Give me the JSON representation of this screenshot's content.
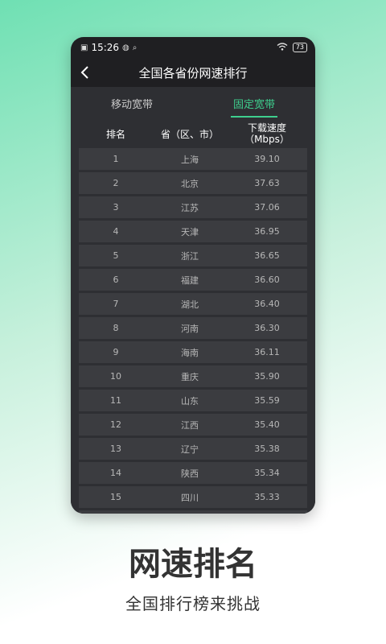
{
  "status_bar": {
    "time": "15:26",
    "battery": "73"
  },
  "nav": {
    "title": "全国各省份网速排行"
  },
  "tabs": [
    {
      "label": "移动宽带",
      "active": false
    },
    {
      "label": "固定宽带",
      "active": true
    }
  ],
  "table": {
    "headers": {
      "rank": "排名",
      "province": "省（区、市）",
      "speed_line1": "下载速度",
      "speed_line2": "（Mbps）"
    },
    "rows": [
      {
        "rank": "1",
        "province": "上海",
        "speed": "39.10"
      },
      {
        "rank": "2",
        "province": "北京",
        "speed": "37.63"
      },
      {
        "rank": "3",
        "province": "江苏",
        "speed": "37.06"
      },
      {
        "rank": "4",
        "province": "天津",
        "speed": "36.95"
      },
      {
        "rank": "5",
        "province": "浙江",
        "speed": "36.65"
      },
      {
        "rank": "6",
        "province": "福建",
        "speed": "36.60"
      },
      {
        "rank": "7",
        "province": "湖北",
        "speed": "36.40"
      },
      {
        "rank": "8",
        "province": "河南",
        "speed": "36.30"
      },
      {
        "rank": "9",
        "province": "海南",
        "speed": "36.11"
      },
      {
        "rank": "10",
        "province": "重庆",
        "speed": "35.90"
      },
      {
        "rank": "11",
        "province": "山东",
        "speed": "35.59"
      },
      {
        "rank": "12",
        "province": "江西",
        "speed": "35.40"
      },
      {
        "rank": "13",
        "province": "辽宁",
        "speed": "35.38"
      },
      {
        "rank": "14",
        "province": "陕西",
        "speed": "35.34"
      },
      {
        "rank": "15",
        "province": "四川",
        "speed": "35.33"
      }
    ]
  },
  "promo": {
    "title": "网速排名",
    "subtitle": "全国排行榜来挑战"
  },
  "colors": {
    "accent": "#3ecf8e",
    "panel": "#2e2f33",
    "row": "#3b3c40"
  }
}
